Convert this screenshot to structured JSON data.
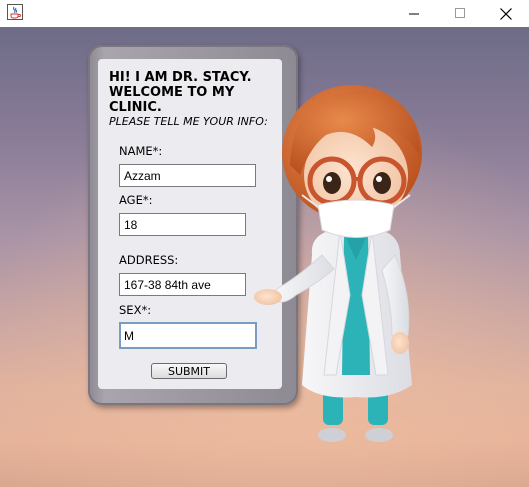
{
  "window": {
    "icon": "java-icon",
    "minimize_symbol": "—",
    "maximize_symbol": "☐",
    "close_symbol": "✕"
  },
  "greeting": {
    "line1": "HI! I AM DR. STACY.",
    "line2": "WELCOME TO MY CLINIC."
  },
  "subtitle": "PLEASE TELL ME YOUR INFO:",
  "form": {
    "name_label": "NAME*:",
    "name_value": "Azzam",
    "age_label": "AGE*:",
    "age_value": "18",
    "address_label": "ADDRESS:",
    "address_value": "167-38 84th ave",
    "sex_label": "SEX*:",
    "sex_value": "M",
    "submit_label": "SUBMIT"
  },
  "colors": {
    "tablet": "#8e8a93",
    "screen": "#ececf0",
    "focus_border": "#7a9cc2",
    "doctor_coat": "#ffffff",
    "scrubs": "#2bb3b8",
    "hair": "#c8612c"
  }
}
